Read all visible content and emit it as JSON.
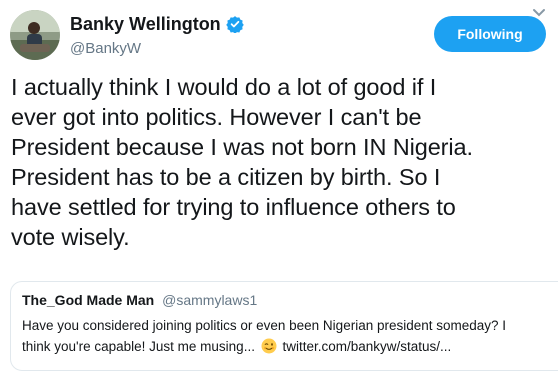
{
  "header": {
    "display_name": "Banky Wellington",
    "handle": "@BankyW",
    "verified_icon": "verified-badge-icon",
    "follow_button_label": "Following",
    "menu_icon": "chevron-down-icon"
  },
  "tweet": {
    "lines": [
      "I actually think I would do a lot of good if I",
      "ever got into politics. However I can't be",
      "President because I was not born IN Nigeria.",
      "President has to be a citizen by birth. So I",
      "have settled for trying to influence others to",
      "vote wisely."
    ]
  },
  "quoted_tweet": {
    "display_name": "The_God Made Man",
    "handle": "@sammylaws1",
    "line1": "Have you considered joining politics or even been Nigerian president someday? I",
    "line2_before_emoji": "think you're capable! Just me musing...",
    "emoji_icon": "winking-face-emoji-icon",
    "line2_link": "twitter.com/bankyw/status/..."
  },
  "colors": {
    "accent": "#1da1f2",
    "text": "#14171a",
    "secondary_text": "#657786",
    "border": "#e1e8ed"
  }
}
